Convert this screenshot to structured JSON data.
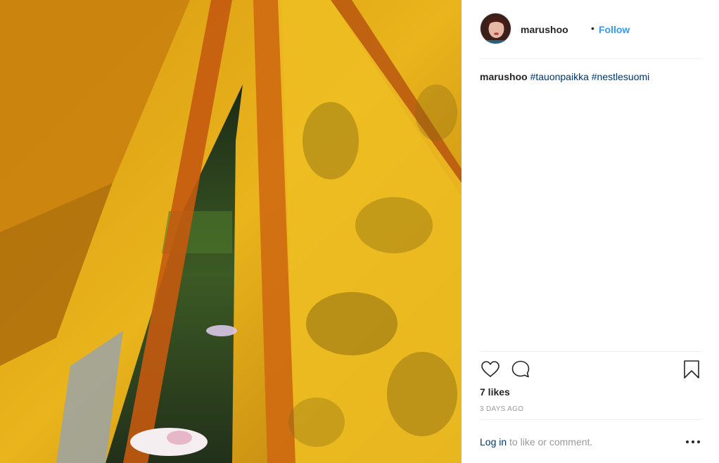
{
  "post": {
    "username": "marushoo",
    "separator": "•",
    "follow_label": "Follow",
    "caption": {
      "username": "marushoo",
      "hashtags": [
        "#tauonpaikka",
        "#nestlesuomi"
      ]
    },
    "likes_text": "7 likes",
    "timestamp": "3 DAYS AGO",
    "login": {
      "link_text": "Log in",
      "rest_text": " to like or comment."
    }
  },
  "icons": {
    "like": "heart-icon",
    "comment": "comment-bubble-icon",
    "save": "bookmark-icon",
    "more": "more-options-icon"
  },
  "colors": {
    "accent": "#3897f0",
    "link": "#003569",
    "muted": "#999999",
    "text": "#262626"
  }
}
